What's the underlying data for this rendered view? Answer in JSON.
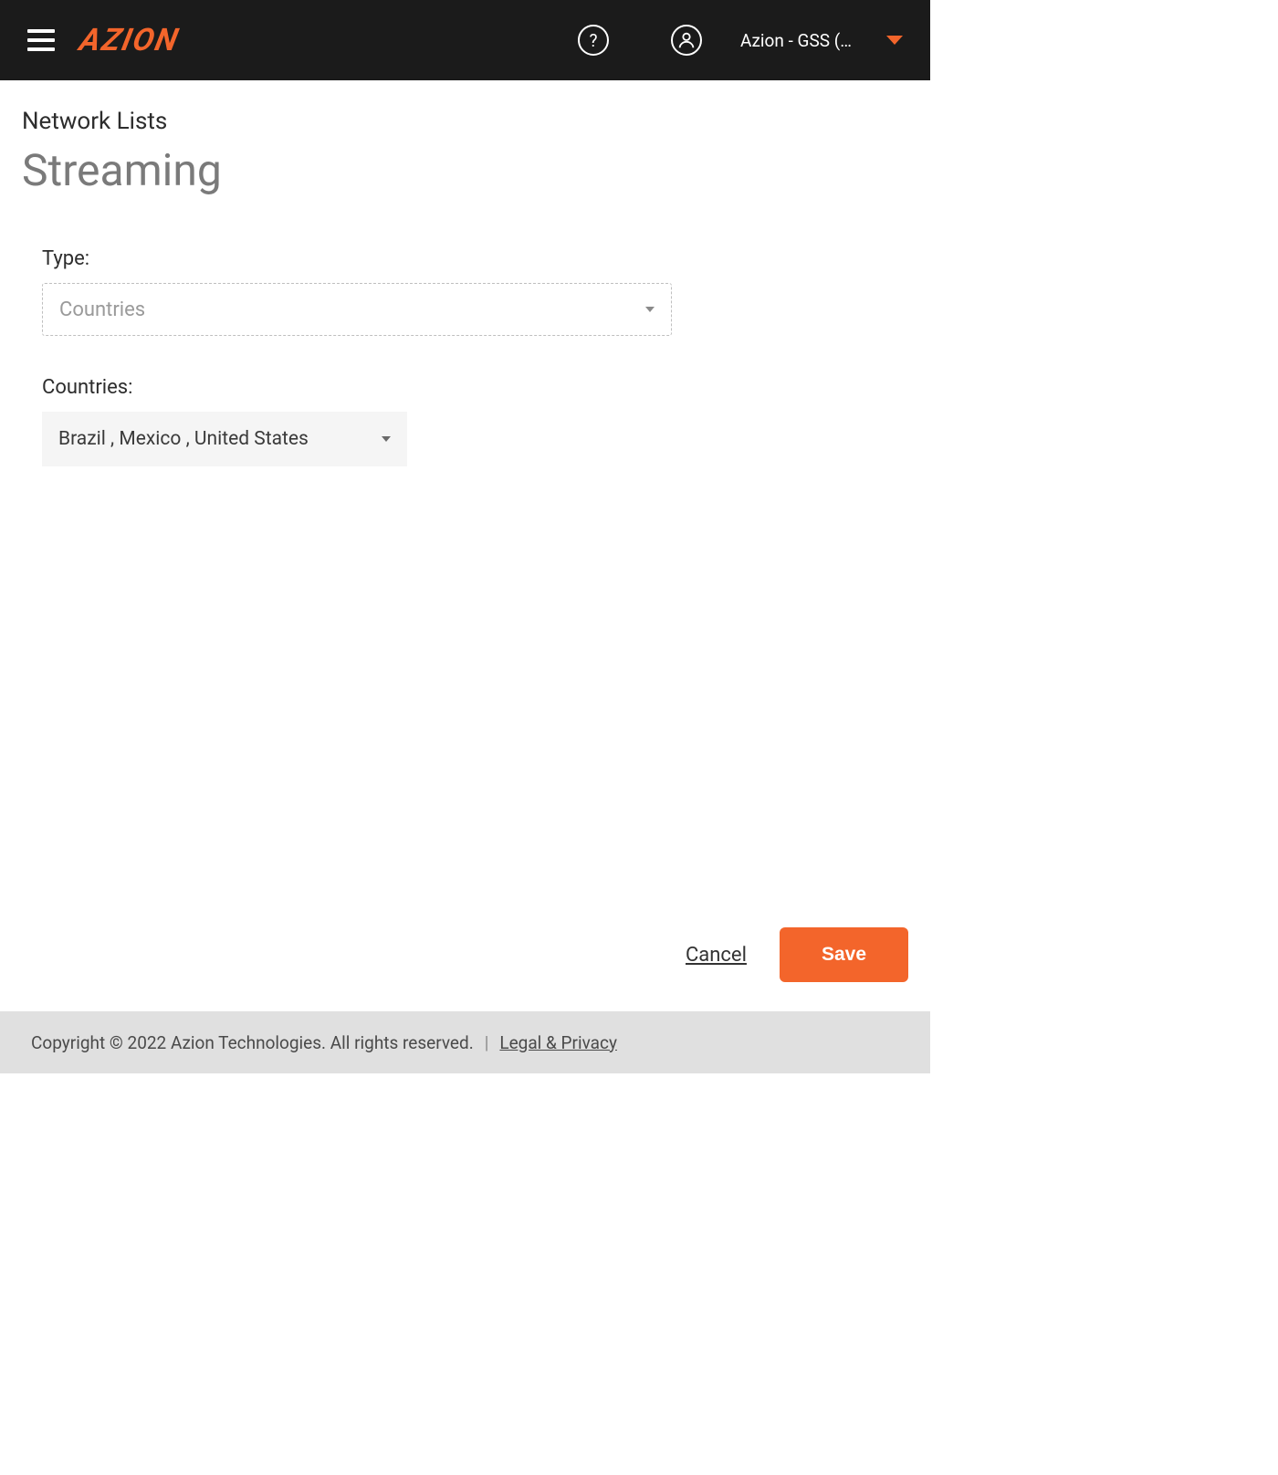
{
  "header": {
    "logo_text": "AZION",
    "help_glyph": "?",
    "account_label": "Azion - GSS (…"
  },
  "title": {
    "breadcrumb": "Network Lists",
    "page_title": "Streaming"
  },
  "form": {
    "type_label": "Type:",
    "type_value": "Countries",
    "countries_label": "Countries:",
    "countries_value": "Brazil , Mexico , United States"
  },
  "actions": {
    "cancel": "Cancel",
    "save": "Save"
  },
  "footer": {
    "copyright": "Copyright © 2022 Azion Technologies. All rights reserved.",
    "divider": "|",
    "legal": "Legal & Privacy"
  }
}
